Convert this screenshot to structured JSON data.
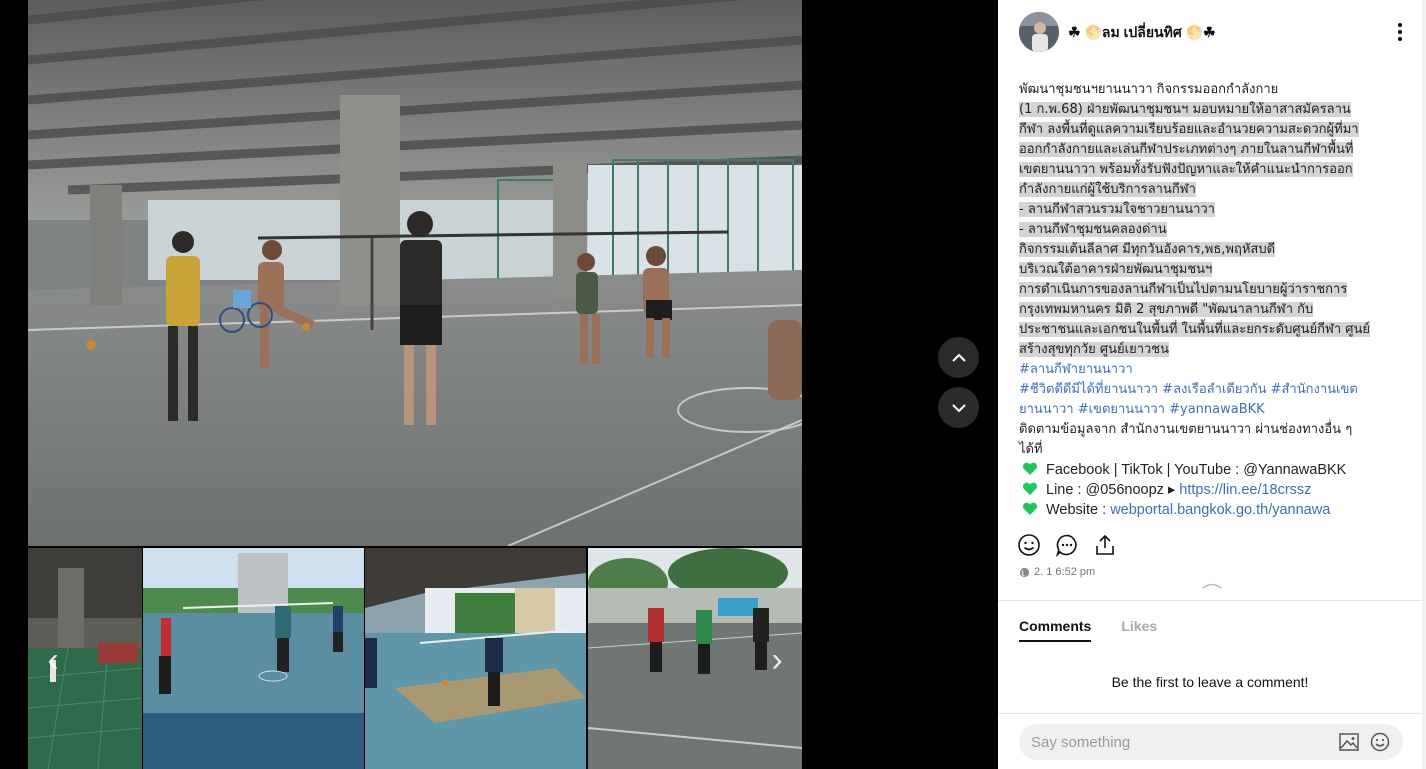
{
  "post": {
    "username": "☘ 🌕ลม เปลี่ยนทิศ 🌕☘",
    "caption_lines": [
      "พัฒนาชุมชนฯยานนาวา กิจกรรมออกกำลังกาย",
      " (1 ก.พ.68)  ฝ่ายพัฒนาชุมชนฯ มอบหมายให้อาสาสมัครลาน",
      "กีฬา ลงพื้นที่ดูแลความเรียบร้อยและอำนวยความสะดวกผู้ที่มา",
      "ออกกำลังกายและเล่นกีฬาประเภทต่างๆ ภายในลานกีฬาพื้นที่",
      "เขตยานนาวา พร้อมทั้งรับฟังปัญหาและให้คำแนะนำการออก",
      "กำลังกายแก่ผู้ใช้บริการลานกีฬา",
      "- ลานกีฬาสวนรวมใจชาวยานนาวา",
      "- ลานกีฬาชุมชนคลองด่าน",
      "กิจกรรมเต้นลีลาศ มีทุกวันอังคาร,พธ,พฤหัสบดี",
      "บริเวณใต้อาคารฝ่ายพัฒนาชุมชนฯ",
      "   การดำเนินการของลานกีฬาเป็นไปตามนโยบายผู้ว่าราชการ",
      "กรุงเทพมหานคร  มิติ 2 สุขภาพดี  \"พัฒนาลานกีฬา กับ",
      "ประชาชนและเอกชนในพื้นที่ ในพื้นที่และยกระดับศูนย์กีฬา ศูนย์",
      "สร้างสุขทุกวัย ศูนย์เยาวชน"
    ],
    "hashtags": [
      "#ลานกีฬายานนาวา",
      "#ชีวิตดีดีมีได้ที่ยานนาวา #ลงเรือลำเดียวกัน #สำนักงานเขต",
      "ยานนาวา #เขตยานนาวา #yannawaBKK"
    ],
    "follow_lines": [
      "ติดตามข้อมูลจาก สำนักงานเขตยานนาวา ผ่านช่องทางอื่น ๆ",
      "ได้ที่"
    ],
    "contacts": {
      "facebook": "Facebook | TikTok | YouTube : @YannawaBKK",
      "line_label": "Line : @056noopz ▸ ",
      "line_url": "https://lin.ee/18crssz",
      "website_label": "Website : ",
      "website_url": "webportal.bangkok.go.th/yannawa"
    },
    "timestamp": "2. 1 6:52 pm"
  },
  "tabs": {
    "comments": "Comments",
    "likes": "Likes"
  },
  "comments": {
    "empty_message": "Be the first to leave a comment!",
    "placeholder": "Say something"
  },
  "icons": {
    "more": "more-vertical-icon",
    "like": "smiley-icon",
    "comment": "comment-icon",
    "share": "share-icon",
    "globe": "globe-icon",
    "heart": "green-heart-icon",
    "nav_up": "chevron-up-icon",
    "nav_down": "chevron-down-icon",
    "thumb_prev": "chevron-left-icon",
    "thumb_next": "chevron-right-icon",
    "image": "image-icon",
    "emoji": "emoji-icon"
  },
  "colors": {
    "link": "#3f6fb6",
    "highlight": "#d4d4d4",
    "heart": "#22c55e",
    "nav_button": "#2b2b2b"
  }
}
